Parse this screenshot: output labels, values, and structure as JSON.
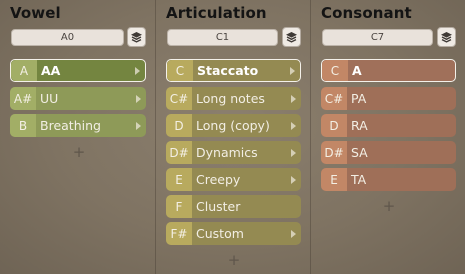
{
  "colors": {
    "vowel_item": "#8e9a58",
    "vowel_key": "#a2ae66",
    "vowel_selected": "#748540",
    "articulation_item": "#948a52",
    "articulation_key": "#b8aa5e",
    "consonant_item": "#9f6f58",
    "consonant_key": "#c28766",
    "consonant_selected": "#a0705a"
  },
  "columns": [
    {
      "title": "Vowel",
      "selector": "A0",
      "items": [
        {
          "key": "A",
          "label": "AA",
          "selected": true,
          "has_arrow": true
        },
        {
          "key": "A#",
          "label": "UU",
          "selected": false,
          "has_arrow": true
        },
        {
          "key": "B",
          "label": "Breathing",
          "selected": false,
          "has_arrow": true
        }
      ],
      "add_label": "+"
    },
    {
      "title": "Articulation",
      "selector": "C1",
      "items": [
        {
          "key": "C",
          "label": "Staccato",
          "selected": true,
          "has_arrow": true
        },
        {
          "key": "C#",
          "label": "Long notes",
          "selected": false,
          "has_arrow": true
        },
        {
          "key": "D",
          "label": "Long (copy)",
          "selected": false,
          "has_arrow": true
        },
        {
          "key": "D#",
          "label": "Dynamics",
          "selected": false,
          "has_arrow": true
        },
        {
          "key": "E",
          "label": "Creepy",
          "selected": false,
          "has_arrow": true
        },
        {
          "key": "F",
          "label": "Cluster",
          "selected": false,
          "has_arrow": false
        },
        {
          "key": "F#",
          "label": "Custom",
          "selected": false,
          "has_arrow": true
        }
      ],
      "add_label": "+"
    },
    {
      "title": "Consonant",
      "selector": "C7",
      "items": [
        {
          "key": "C",
          "label": "A",
          "selected": true,
          "has_arrow": false
        },
        {
          "key": "C#",
          "label": "PA",
          "selected": false,
          "has_arrow": false
        },
        {
          "key": "D",
          "label": "RA",
          "selected": false,
          "has_arrow": false
        },
        {
          "key": "D#",
          "label": "SA",
          "selected": false,
          "has_arrow": false
        },
        {
          "key": "E",
          "label": "TA",
          "selected": false,
          "has_arrow": false
        }
      ],
      "add_label": "+"
    }
  ]
}
